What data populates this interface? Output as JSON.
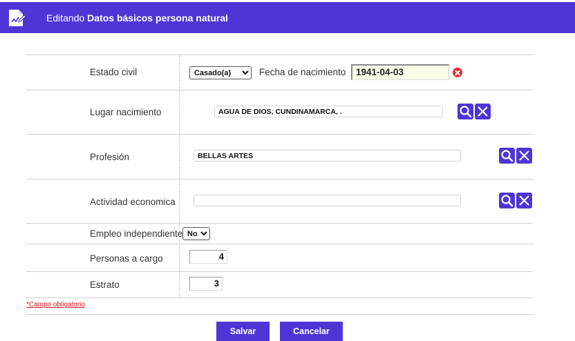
{
  "header": {
    "prefix": "Editando",
    "title": "Datos básicos persona natural",
    "icon": "edit-document-icon"
  },
  "form": {
    "estado_civil": {
      "label": "Estado civil",
      "value": "Casado(a)"
    },
    "fecha_nacimiento": {
      "label": "Fecha de nacimiento",
      "value": "1941-04-03"
    },
    "lugar_nacimiento": {
      "label": "Lugar nacimiento",
      "value": "AGUA DE DIOS, CUNDINAMARCA, ."
    },
    "profesion": {
      "label": "Profesión",
      "value": "BELLAS ARTES"
    },
    "actividad_economica": {
      "label": "Actividad economica",
      "value": ""
    },
    "empleo_independiente": {
      "label": "Empleo independiente",
      "value": "No"
    },
    "personas_a_cargo": {
      "label": "Personas a cargo",
      "value": "4"
    },
    "estrato": {
      "label": "Estrato",
      "value": "3"
    }
  },
  "required_note": "*Campo obligatorio",
  "buttons": {
    "save": "Salvar",
    "cancel": "Cancelar"
  },
  "colors": {
    "accent": "#4f35d6",
    "error": "#d6322f",
    "required": "#d2141d"
  }
}
